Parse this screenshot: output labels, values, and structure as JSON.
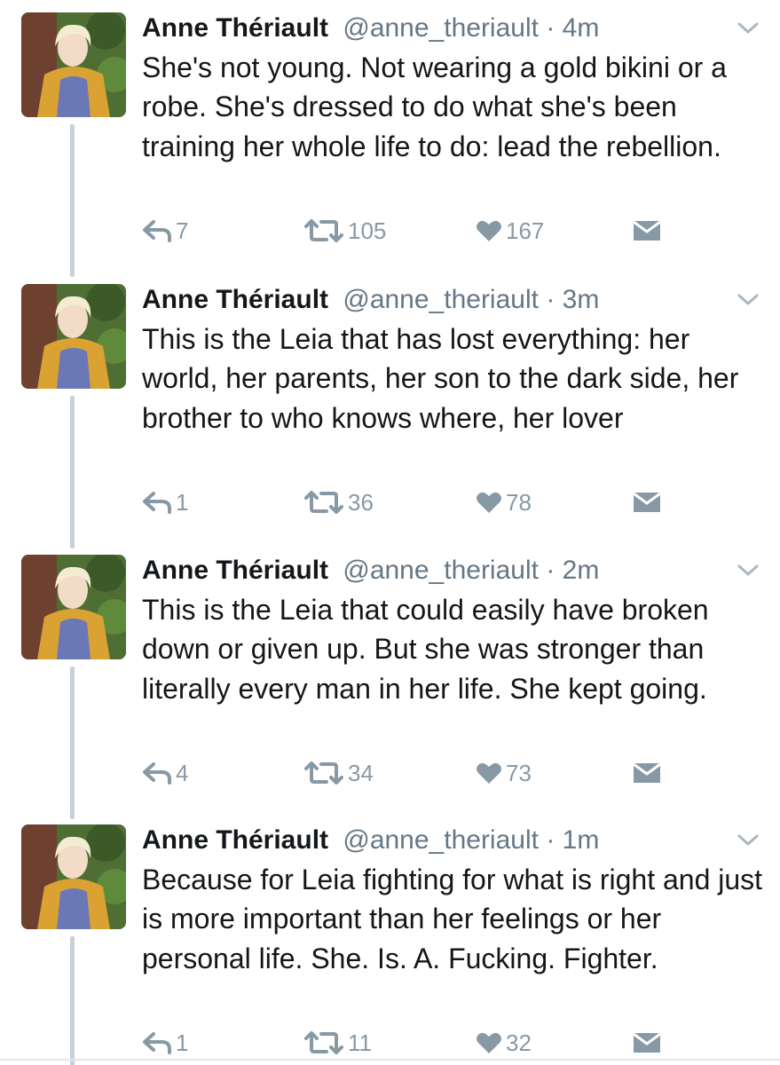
{
  "colors": {
    "name": "#14171a",
    "meta": "#657786",
    "action": "#8899a6",
    "thread_line": "#c7d1d9"
  },
  "tweets": [
    {
      "name": "Anne Thériault",
      "handle": "@anne_theriault",
      "separator": "·",
      "time": "4m",
      "text": "She's not young. Not wearing a gold bikini or a robe. She's dressed to do what she's been training her whole life to do: lead the rebellion.",
      "replies": "7",
      "retweets": "105",
      "likes": "167"
    },
    {
      "name": "Anne Thériault",
      "handle": "@anne_theriault",
      "separator": "·",
      "time": "3m",
      "text": "This is the Leia that has lost everything: her world, her parents, her son to the dark side, her brother to who knows where, her lover",
      "replies": "1",
      "retweets": "36",
      "likes": "78"
    },
    {
      "name": "Anne Thériault",
      "handle": "@anne_theriault",
      "separator": "·",
      "time": "2m",
      "text": "This is the Leia that could easily have broken down or given up. But she was stronger than literally every man in her life. She kept going.",
      "replies": "4",
      "retweets": "34",
      "likes": "73"
    },
    {
      "name": "Anne Thériault",
      "handle": "@anne_theriault",
      "separator": "·",
      "time": "1m",
      "text": "Because for Leia fighting for what is right and just is more important than her feelings or her personal life. She. Is. A. Fucking. Fighter.",
      "replies": "1",
      "retweets": "11",
      "likes": "32"
    }
  ],
  "icons": {
    "avatar": "avatar",
    "reply": "reply-icon",
    "retweet": "retweet-icon",
    "like": "heart-icon",
    "dm": "envelope-icon",
    "more": "chevron-down-icon"
  }
}
